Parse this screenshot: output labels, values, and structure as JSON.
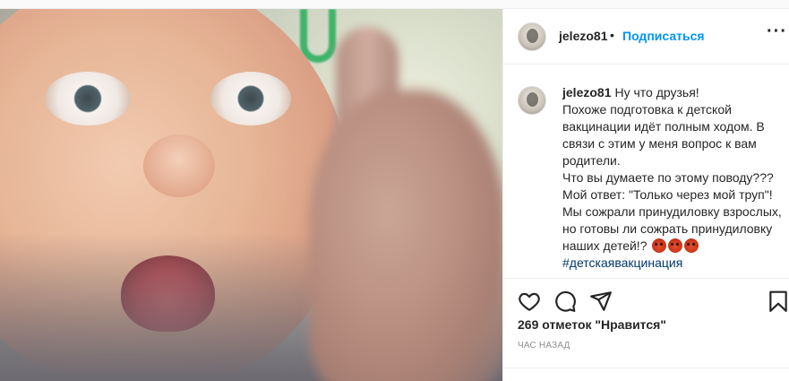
{
  "post": {
    "username": "jelezo81",
    "separator": "•",
    "follow_label": "Подписаться",
    "more_label": "···",
    "caption": {
      "username": "jelezo81",
      "lines": [
        "Ну что друзья!",
        "Похоже подготовка к детской вакцинации идёт полным ходом. В связи с этим у меня вопрос к вам родители.",
        "Что вы думаете по этому поводу???",
        "Мой ответ: \"Только через мой труп\"!",
        "Мы сожрали принудиловку взрослых, но готовы ли сожрать принудиловку наших детей!?"
      ],
      "emojis": [
        "angry-face-emoji",
        "angry-face-emoji",
        "angry-face-emoji"
      ],
      "hashtag": "#детскаявакцинация"
    },
    "likes_text": "269 отметок \"Нравится\"",
    "time_text": "час назад"
  },
  "colors": {
    "accent": "#0095f6",
    "text": "#262626",
    "muted": "#8e8e8e",
    "hashtag": "#00376b",
    "border": "#efefef"
  },
  "icons": {
    "like": "heart-icon",
    "comment": "comment-icon",
    "share": "paper-plane-icon",
    "save": "bookmark-icon"
  }
}
